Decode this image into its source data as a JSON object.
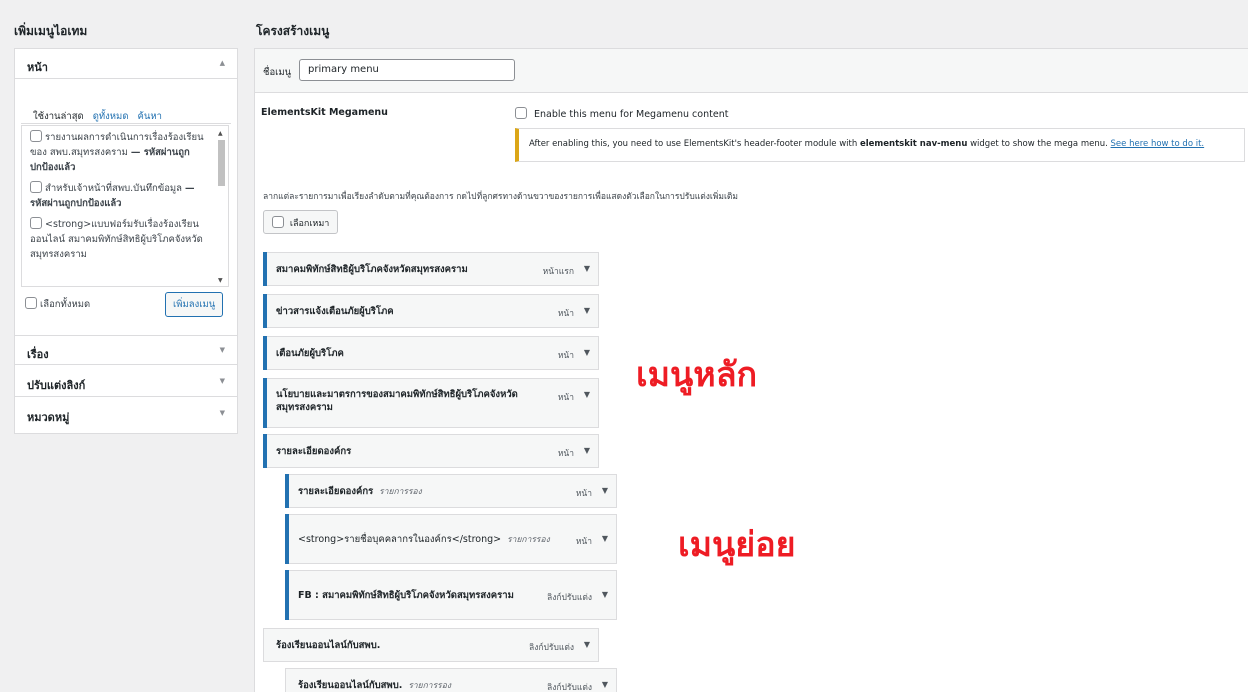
{
  "left": {
    "heading": "เพิ่มเมนูไอเทม",
    "pages_section": "หน้า",
    "tabs": [
      "ใช้งานล่าสุด",
      "ดูทั้งหมด",
      "ค้นหา"
    ],
    "items": [
      {
        "text": "รายงานผลการดำเนินการเรื่องร้องเรียนของ สพบ.สมุทรสงคราม",
        "suffix": "— รหัสผ่านถูกปกป้องแล้ว"
      },
      {
        "text": "สำหรับเจ้าหน้าที่สพบ.บันทึกข้อมูล",
        "suffix": "— รหัสผ่านถูกปกป้องแล้ว"
      },
      {
        "text": "<strong>แบบฟอร์มรับเรื่องร้องเรียนออนไลน์ สมาคมพิทักษ์สิทธิผู้บริโภคจังหวัดสมุทรสงคราม",
        "suffix": ""
      }
    ],
    "select_all": "เลือกทั้งหมด",
    "add_button": "เพิ่มลงเมนู",
    "sections": [
      "เรื่อง",
      "ปรับแต่งลิงก์",
      "หมวดหมู่"
    ]
  },
  "right": {
    "heading": "โครงสร้างเมนู",
    "menu_name_label": "ชื่อเมนู",
    "menu_name_value": "primary menu",
    "megamenu_label": "ElementsKit Megamenu",
    "megamenu_checkbox": "Enable this menu for Megamenu content",
    "notice_text_before": "After enabling this, you need to use ElementsKit's header-footer module with ",
    "notice_bold": "elementskit nav-menu",
    "notice_text_after": " widget to show the mega menu. ",
    "notice_link": "See here how to do it.",
    "instructions": "ลากแต่ละรายการมาเพื่อเรียงลำดับตามที่คุณต้องการ กดไปที่ลูกศรทางด้านขวาของรายการเพื่อแสดงตัวเลือกในการปรับแต่งเพิ่มเติม",
    "bulk_select": "เลือกเหมา",
    "menu_items": [
      {
        "title": "สมาคมพิทักษ์สิทธิผู้บริโภคจังหวัดสมุทรสงคราม",
        "sub": "",
        "type": "หน้าแรก"
      },
      {
        "title": "ข่าวสารแจ้งเตือนภัยผู้บริโภค",
        "sub": "",
        "type": "หน้า"
      },
      {
        "title": "เตือนภัยผู้บริโภค",
        "sub": "",
        "type": "หน้า"
      },
      {
        "title": "นโยบายและมาตรการของสมาคมพิทักษ์สิทธิผู้บริโภคจังหวัดสมุทรสงคราม",
        "sub": "",
        "type": "หน้า"
      },
      {
        "title": "รายละเอียดองค์กร",
        "sub": "",
        "type": "หน้า"
      },
      {
        "title": "รายละเอียดองค์กร",
        "sub": "รายการรอง",
        "type": "หน้า"
      },
      {
        "title": "<strong>รายชื่อบุคคลากรในองค์กร</strong>",
        "sub": "รายการรอง",
        "type": "หน้า"
      },
      {
        "title": "FB : สมาคมพิทักษ์สิทธิผู้บริโภคจังหวัดสมุทรสงคราม",
        "sub": "",
        "type": "ลิงก์ปรับแต่ง"
      },
      {
        "title": "ร้องเรียนออนไลน์กับสพบ.",
        "sub": "",
        "type": "ลิงก์ปรับแต่ง"
      },
      {
        "title": "ร้องเรียนออนไลน์กับสพบ.",
        "sub": "รายการรอง",
        "type": "ลิงก์ปรับแต่ง"
      }
    ]
  },
  "annotations": {
    "main_menu": "เมนูหลัก",
    "sub_menu": "เมนูย่อย"
  },
  "colors": {
    "accent": "#2271b1",
    "annotation": "#ee1c24",
    "notice_border": "#dba617"
  }
}
